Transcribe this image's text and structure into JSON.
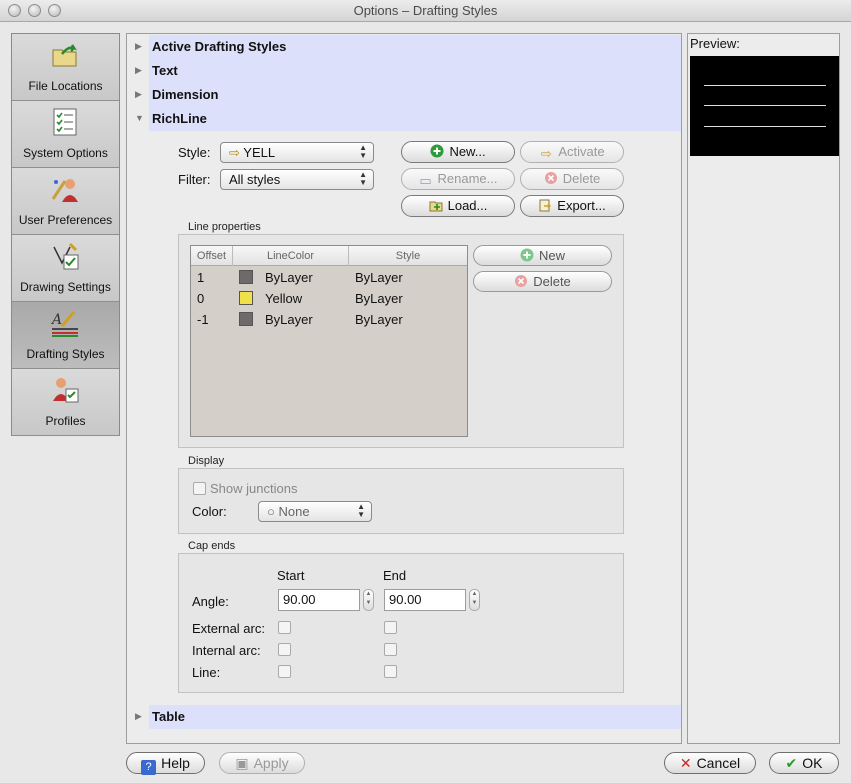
{
  "window": {
    "title": "Options – Drafting Styles"
  },
  "sidebar": {
    "items": [
      {
        "label": "File Locations",
        "icon": "folder-arrow-icon"
      },
      {
        "label": "System Options",
        "icon": "checklist-icon"
      },
      {
        "label": "User Preferences",
        "icon": "user-preferences-icon"
      },
      {
        "label": "Drawing Settings",
        "icon": "drawing-settings-icon"
      },
      {
        "label": "Drafting Styles",
        "icon": "drafting-styles-icon",
        "active": true
      },
      {
        "label": "Profiles",
        "icon": "profiles-icon"
      }
    ]
  },
  "sections": {
    "active_styles": "Active Drafting Styles",
    "text": "Text",
    "dimension": "Dimension",
    "richline": "RichLine",
    "table": "Table"
  },
  "richline": {
    "style_label": "Style:",
    "style_value": "YELL",
    "filter_label": "Filter:",
    "filter_value": "All styles",
    "buttons": {
      "new": "New...",
      "activate": "Activate",
      "rename": "Rename...",
      "delete": "Delete",
      "load": "Load...",
      "export": "Export..."
    }
  },
  "line_properties": {
    "title": "Line properties",
    "columns": [
      "Offset",
      "LineColor",
      "Style"
    ],
    "rows": [
      {
        "offset": "1",
        "color": "ByLayer",
        "swatch": "#6e6a6a",
        "style": "ByLayer"
      },
      {
        "offset": "0",
        "color": "Yellow",
        "swatch": "#f0e04a",
        "style": "ByLayer"
      },
      {
        "offset": "-1",
        "color": "ByLayer",
        "swatch": "#6e6a6a",
        "style": "ByLayer"
      }
    ],
    "new_button": "New",
    "delete_button": "Delete"
  },
  "display": {
    "title": "Display",
    "show_junctions": "Show junctions",
    "color_label": "Color:",
    "color_value": "None"
  },
  "cap_ends": {
    "title": "Cap ends",
    "start_header": "Start",
    "end_header": "End",
    "angle_label": "Angle:",
    "angle_start": "90.00",
    "angle_end": "90.00",
    "external_arc": "External arc:",
    "internal_arc": "Internal arc:",
    "line": "Line:"
  },
  "preview": {
    "label": "Preview:"
  },
  "footer": {
    "help": "Help",
    "apply": "Apply",
    "cancel": "Cancel",
    "ok": "OK"
  },
  "colors": {
    "section_bg": "#dde0fa",
    "ok_check": "#2a9a2a",
    "cancel_x": "#cc2222"
  }
}
